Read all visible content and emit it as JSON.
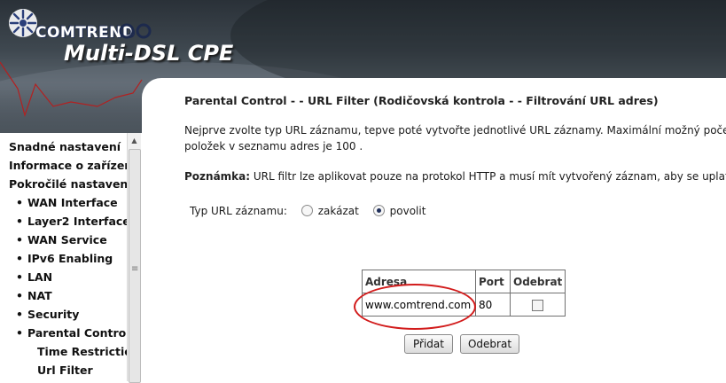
{
  "banner": {
    "brand": "COMTREND",
    "product": "Multi-DSL CPE"
  },
  "nav": {
    "items": [
      {
        "label": "Snadné nastavení"
      },
      {
        "label": "Informace o zařízení"
      },
      {
        "label": "Pokročilé nastavení"
      }
    ],
    "sub_items": [
      {
        "label": "WAN Interface"
      },
      {
        "label": "Layer2 Interface"
      },
      {
        "label": "WAN Service"
      },
      {
        "label": "IPv6 Enabling"
      },
      {
        "label": "LAN"
      },
      {
        "label": "NAT"
      },
      {
        "label": "Security"
      },
      {
        "label": "Parental Control"
      }
    ],
    "sub_sub_items": [
      {
        "label": "Time Restriction"
      },
      {
        "label": "Url Filter"
      }
    ]
  },
  "main": {
    "heading": "Parental Control - - URL Filter (Rodičovská kontrola - - Filtrování URL adres)",
    "desc_line1": "Nejprve zvolte typ URL záznamu, tepve poté vytvořte jednotlivé URL záznamy. Maximální možný počet",
    "desc_line2": "položek v seznamu adres je 100 .",
    "note_label": "Poznámka:",
    "note_text": " URL filtr lze aplikovat pouze na protokol HTTP a musí mít vytvořený záznam, aby se uplatnil.",
    "type_label": "Typ URL záznamu:",
    "options": [
      {
        "label": "zakázat",
        "checked": false
      },
      {
        "label": "povolit",
        "checked": true
      }
    ],
    "table": {
      "headers": [
        "Adresa",
        "Port",
        "Odebrat"
      ],
      "rows": [
        {
          "address": "www.comtrend.com",
          "port": "80",
          "remove_checked": false
        }
      ]
    },
    "buttons": {
      "add": "Přidat",
      "remove": "Odebrat"
    }
  }
}
